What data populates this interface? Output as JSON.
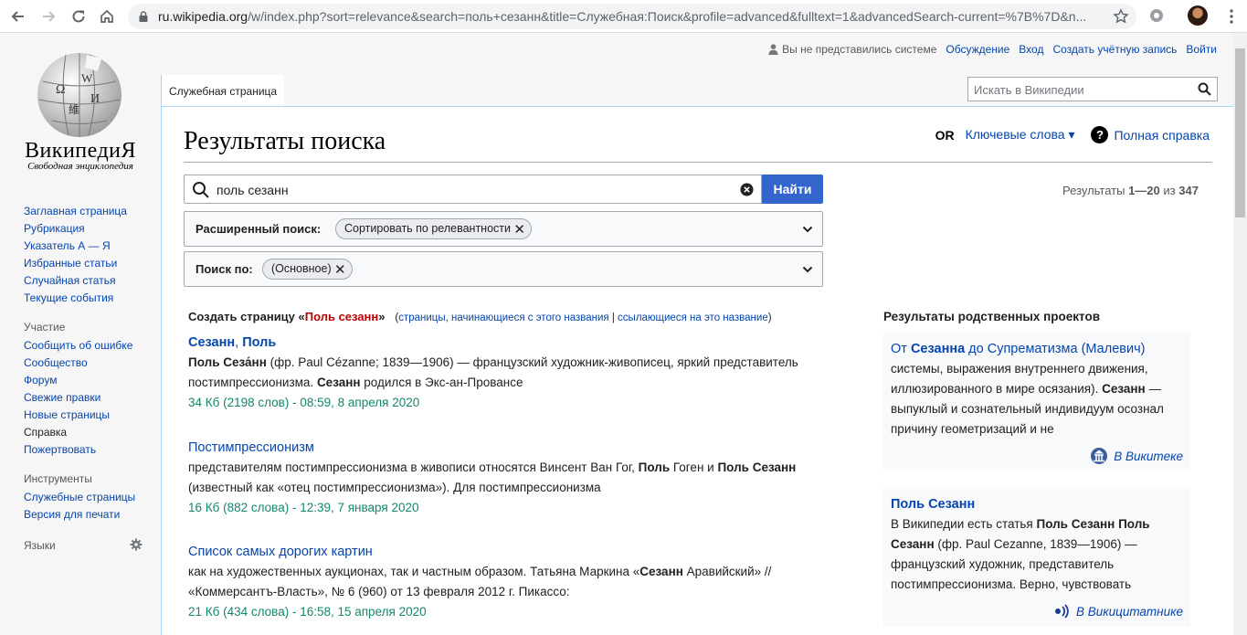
{
  "browser": {
    "url_host": "ru.wikipedia.org",
    "url_rest": "/w/index.php?sort=relevance&search=поль+сезанн&title=Служебная:Поиск&profile=advanced&fulltext=1&advancedSearch-current=%7B%7D&n..."
  },
  "logo": {
    "wordmark": "ВикипедиЯ",
    "tagline": "Свободная энциклопедия"
  },
  "sidebar": {
    "main": [
      "Заглавная страница",
      "Рубрикация",
      "Указатель А — Я",
      "Избранные статьи",
      "Случайная статья",
      "Текущие события"
    ],
    "participation_title": "Участие",
    "participation": [
      "Сообщить об ошибке",
      "Сообщество",
      "Форум",
      "Свежие правки",
      "Новые страницы",
      "Справка",
      "Пожертвовать"
    ],
    "tools_title": "Инструменты",
    "tools": [
      "Служебные страницы",
      "Версия для печати"
    ],
    "languages_title": "Языки"
  },
  "personal": {
    "user": "Вы не представились системе",
    "talk": "Обсуждение",
    "login": "Вход",
    "create": "Создать учётную запись",
    "logout": "Войти"
  },
  "tab": "Служебная страница",
  "search_placeholder": "Искать в Википедии",
  "page_title": "Результаты поиска",
  "indicators": {
    "or": "OR",
    "keywords": "Ключевые слова ▾",
    "help_mark": "?",
    "help": "Полная справка"
  },
  "search": {
    "value": "поль сезанн",
    "button": "Найти",
    "advanced_label": "Расширенный поиск:",
    "advanced_chip": "Сортировать по релевантности",
    "search_in_label": "Поиск по:",
    "search_in_chip": "(Основное)"
  },
  "results_count": {
    "prefix": "Результаты ",
    "range": "1—20",
    "middle": " из ",
    "total": "347"
  },
  "create_page": {
    "prefix": "Создать страницу «",
    "name": "Поль сезанн",
    "suffix": "»",
    "open": "(",
    "link1": "страницы, начинающиеся с этого названия",
    "sep": " | ",
    "link2": "ссылающиеся на это название",
    "close": ")"
  },
  "results": [
    {
      "title_b1": "Сезанн",
      "title_sep": ", ",
      "title_b2": "Поль",
      "snip1_b": "Поль Сеза́нн",
      "snip1": " (фр. Paul Cézanne; 1839—1906) — французский художник-живописец, яркий представитель постимпрессионизма. ",
      "snip2_b": "Сезанн",
      "snip2": " родился в Экс-ан-Провансе",
      "meta": "34 Кб (2198 слов) - 08:59, 8 апреля 2020"
    },
    {
      "title": "Постимпрессионизм",
      "snip1": "представителям постимпрессионизма в живописи относятся Винсент Ван Гог, ",
      "snip1_b": "Поль",
      "snip2": " Гоген и ",
      "snip2_b": "Поль Сезанн",
      "snip3": " (известный как «отец постимпрессионизма»). Для постимпрессионизма",
      "meta": "16 Кб (882 слова) - 12:39, 7 января 2020"
    },
    {
      "title": "Список самых дорогих картин",
      "snip1": "как на художественных аукционах, так и частным образом. Татьяна Маркина «",
      "snip1_b": "Сезанн",
      "snip2": " Аравийский» // «Коммерсантъ-Власть», № 6 (960) от 13 февраля 2012 г. Пикассо:",
      "meta": "21 Кб (434 слова) - 16:58, 15 апреля 2020"
    }
  ],
  "sister": {
    "heading": "Результаты родственных проектов",
    "items": [
      {
        "title_pre": "От ",
        "title_b": "Сезанна",
        "title_post": " до Супрематизма (Малевич)",
        "text1": "системы, выражения внутреннего движения, иллюзированного в мире осязания). ",
        "text_b": "Сезанн",
        "text2": " — выпуклый и сознательный индивидуум осознал причину геометризаций и не",
        "source": "В Викитеке"
      },
      {
        "title_b": "Поль Сезанн",
        "text1": "В Википедии есть статья ",
        "text_b": "Поль Сезанн Поль Сезанн",
        "text2": " (фр. Paul Cezanne, 1839—1906) — французский художник, представитель постимпрессионизма. Верно, чувствовать",
        "source": "В Викицитатнике"
      }
    ]
  }
}
